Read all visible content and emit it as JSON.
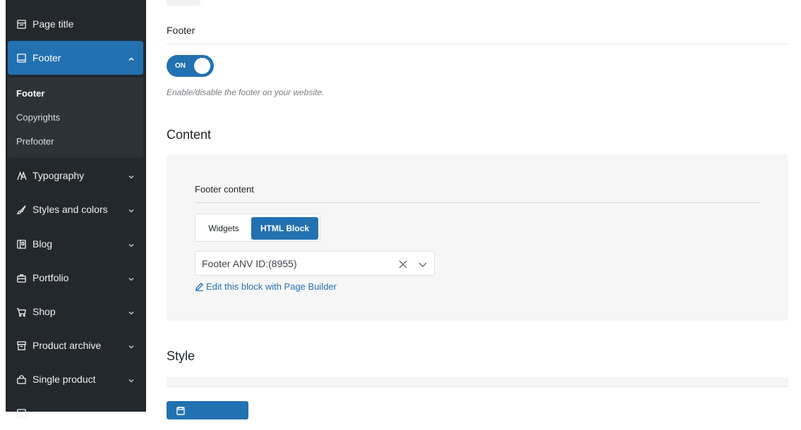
{
  "sidebar": {
    "items": [
      {
        "label": "Page title",
        "icon": "page-title-icon"
      },
      {
        "label": "Footer",
        "icon": "footer-icon"
      },
      {
        "label": "Typography",
        "icon": "typography-icon"
      },
      {
        "label": "Styles and colors",
        "icon": "brush-icon"
      },
      {
        "label": "Blog",
        "icon": "blog-icon"
      },
      {
        "label": "Portfolio",
        "icon": "briefcase-icon"
      },
      {
        "label": "Shop",
        "icon": "cart-icon"
      },
      {
        "label": "Product archive",
        "icon": "archive-icon"
      },
      {
        "label": "Single product",
        "icon": "bag-icon"
      }
    ],
    "footer_subitems": [
      "Footer",
      "Copyrights",
      "Prefooter"
    ]
  },
  "main": {
    "footer_field_title": "Footer",
    "toggle_label": "ON",
    "toggle_state": true,
    "toggle_description": "Enable/disable the footer on your website.",
    "content_section_title": "Content",
    "footer_content_title": "Footer content",
    "content_tabs": [
      "Widgets",
      "HTML Block"
    ],
    "selected_tab": "HTML Block",
    "selected_block": "Footer ANV ID:(8955)",
    "edit_link": "Edit this block with Page Builder",
    "style_section_title": "Style"
  },
  "colors": {
    "accent": "#2271b1",
    "sidebar_bg": "#23282d",
    "submenu_bg": "#2c3338"
  }
}
